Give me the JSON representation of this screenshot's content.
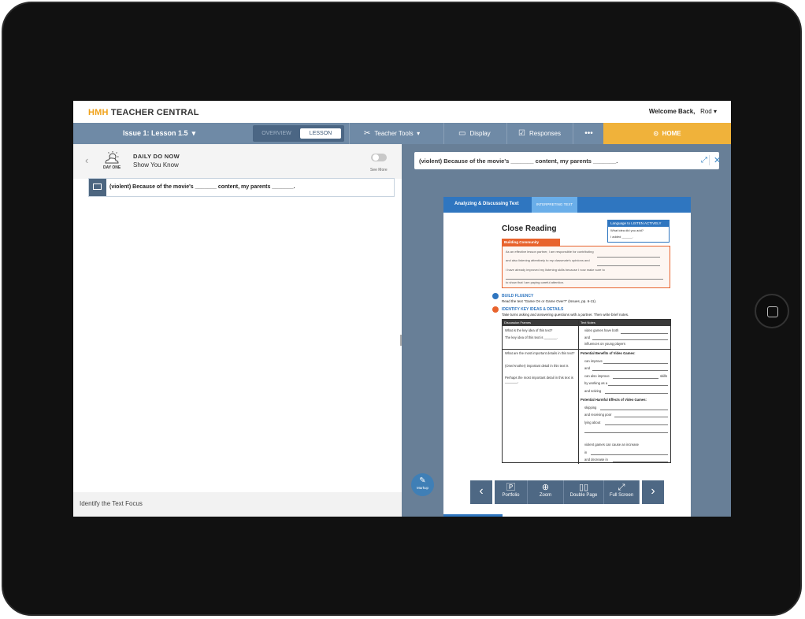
{
  "header": {
    "logo_prefix": "HMH",
    "logo_text": "TEACHER CENTRAL",
    "welcome": "Welcome Back,",
    "user": "Rod"
  },
  "nav": {
    "lesson_label": "Issue 1: Lesson 1.5",
    "toggle_overview": "OVERVIEW",
    "toggle_lesson": "LESSON",
    "teacher_tools": "Teacher Tools",
    "display": "Display",
    "responses": "Responses",
    "more": "•••",
    "home": "HOME"
  },
  "left": {
    "day_label": "DAY ONE",
    "title": "DAILY DO NOW",
    "subtitle": "Show You Know",
    "see_more": "See More",
    "item_text": "(violent) Because of the movie's _______ content, my parents _______.",
    "footer": "Identify the Text Focus"
  },
  "right": {
    "prompt": "(violent) Because of the movie's _______ content, my parents _______.",
    "page": {
      "banner_title": "Analyzing & Discussing Text",
      "banner_tab": "INTERPRETING TEXT",
      "heading": "Close Reading",
      "lang_head": "Language to LISTEN ACTIVELY",
      "lang_l1": "What idea did you add?",
      "lang_l2": "I added ______.",
      "building_community": "Building Community",
      "bc_l1": "As an effective lesson partner, I am responsible for contributing",
      "bc_l2": "and also listening attentively to my classmate's opinions and",
      "bc_l3": "I have already improved my listening skills because I now make sure to",
      "bc_l4": "to show that I am paying careful attention.",
      "bf_title": "BUILD FLUENCY",
      "bf_sub": "Read the text \"Game On or Game Over?\" (Issues, pp. 6-11).",
      "ik_title": "IDENTIFY KEY IDEAS & DETAILS",
      "ik_sub": "Take turns asking and answering questions with a partner. Then write brief notes.",
      "th_frames": "Discussion Frames",
      "th_notes": "Text Notes",
      "q1": "What is the key idea of this text?",
      "a1": "The key idea of this text is _______.",
      "n1a": "video games have both",
      "n1b": "and",
      "n1c": "influences on young players",
      "q2": "What are the most important details in this text?",
      "a2": "(One/Another) important detail in this text is",
      "a3": "Perhaps the most important detail in this text is _______.",
      "benefits": "Potential Benefits of Video Games:",
      "b1": "can improve",
      "b2": "and",
      "b3": "can also improve",
      "b3b": "skills",
      "b4": "by working as a",
      "b5": "and solving",
      "harmful": "Potential Harmful Effects of Video Games:",
      "h1": "skipping",
      "h2": "and receiving poor",
      "h3": "lying about",
      "h4": "violent games can cause an increase",
      "h5": "in",
      "h6": "and decrease in"
    },
    "toolbar": {
      "portfolio": "Portfolio",
      "zoom": "Zoom",
      "double_page": "Double Page",
      "full_screen": "Full Screen",
      "markup": "Markup"
    }
  }
}
